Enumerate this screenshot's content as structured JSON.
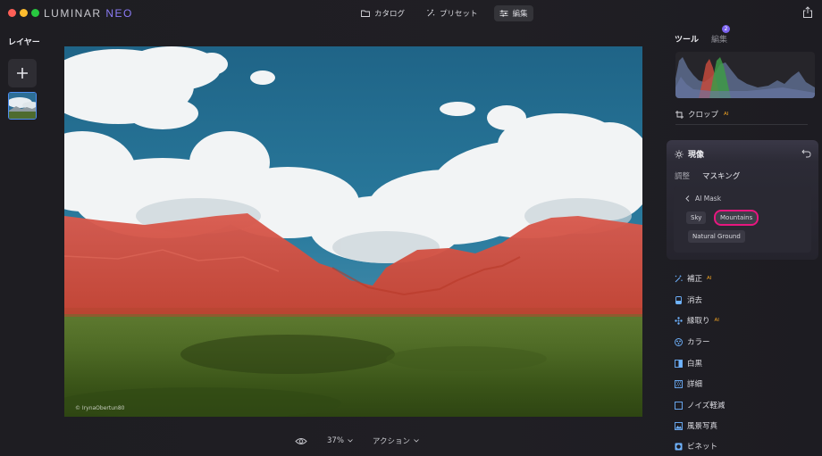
{
  "app": {
    "brand_main": "LUMINAR ",
    "brand_accent": "NEO"
  },
  "topnav": {
    "catalog": "カタログ",
    "presets": "プリセット",
    "edit": "編集"
  },
  "layers": {
    "title": "レイヤー"
  },
  "canvas": {
    "watermark": "© IrynaObertun80"
  },
  "bottombar": {
    "zoom": "37%",
    "actions": "アクション"
  },
  "rightpanel": {
    "tab_tools": "ツール",
    "tab_edits": "編集",
    "edits_badge": "2",
    "crop": "クロップ",
    "ai_tag": "AI",
    "develop": {
      "title": "現像",
      "tab_adjust": "調整",
      "tab_masking": "マスキング",
      "ai_mask_back": "AI Mask",
      "chips": [
        "Sky",
        "Mountains",
        "Natural Ground"
      ]
    },
    "tools": [
      {
        "label": "補正",
        "icon": "enhance-icon",
        "ai": true
      },
      {
        "label": "消去",
        "icon": "erase-icon",
        "ai": false
      },
      {
        "label": "縁取り",
        "icon": "structure-icon",
        "ai": true
      },
      {
        "label": "カラー",
        "icon": "color-icon",
        "ai": false
      },
      {
        "label": "白黒",
        "icon": "bw-icon",
        "ai": false
      },
      {
        "label": "詳細",
        "icon": "details-icon",
        "ai": false
      },
      {
        "label": "ノイズ軽減",
        "icon": "denoise-icon",
        "ai": false
      },
      {
        "label": "風景写真",
        "icon": "landscape-icon",
        "ai": false
      },
      {
        "label": "ビネット",
        "icon": "vignette-icon",
        "ai": false
      }
    ]
  },
  "colors": {
    "accent_purple": "#8b7cf6",
    "selection_pink": "#e8167f",
    "ai_orange": "#f5a623",
    "mask_red": "#d9473f"
  }
}
